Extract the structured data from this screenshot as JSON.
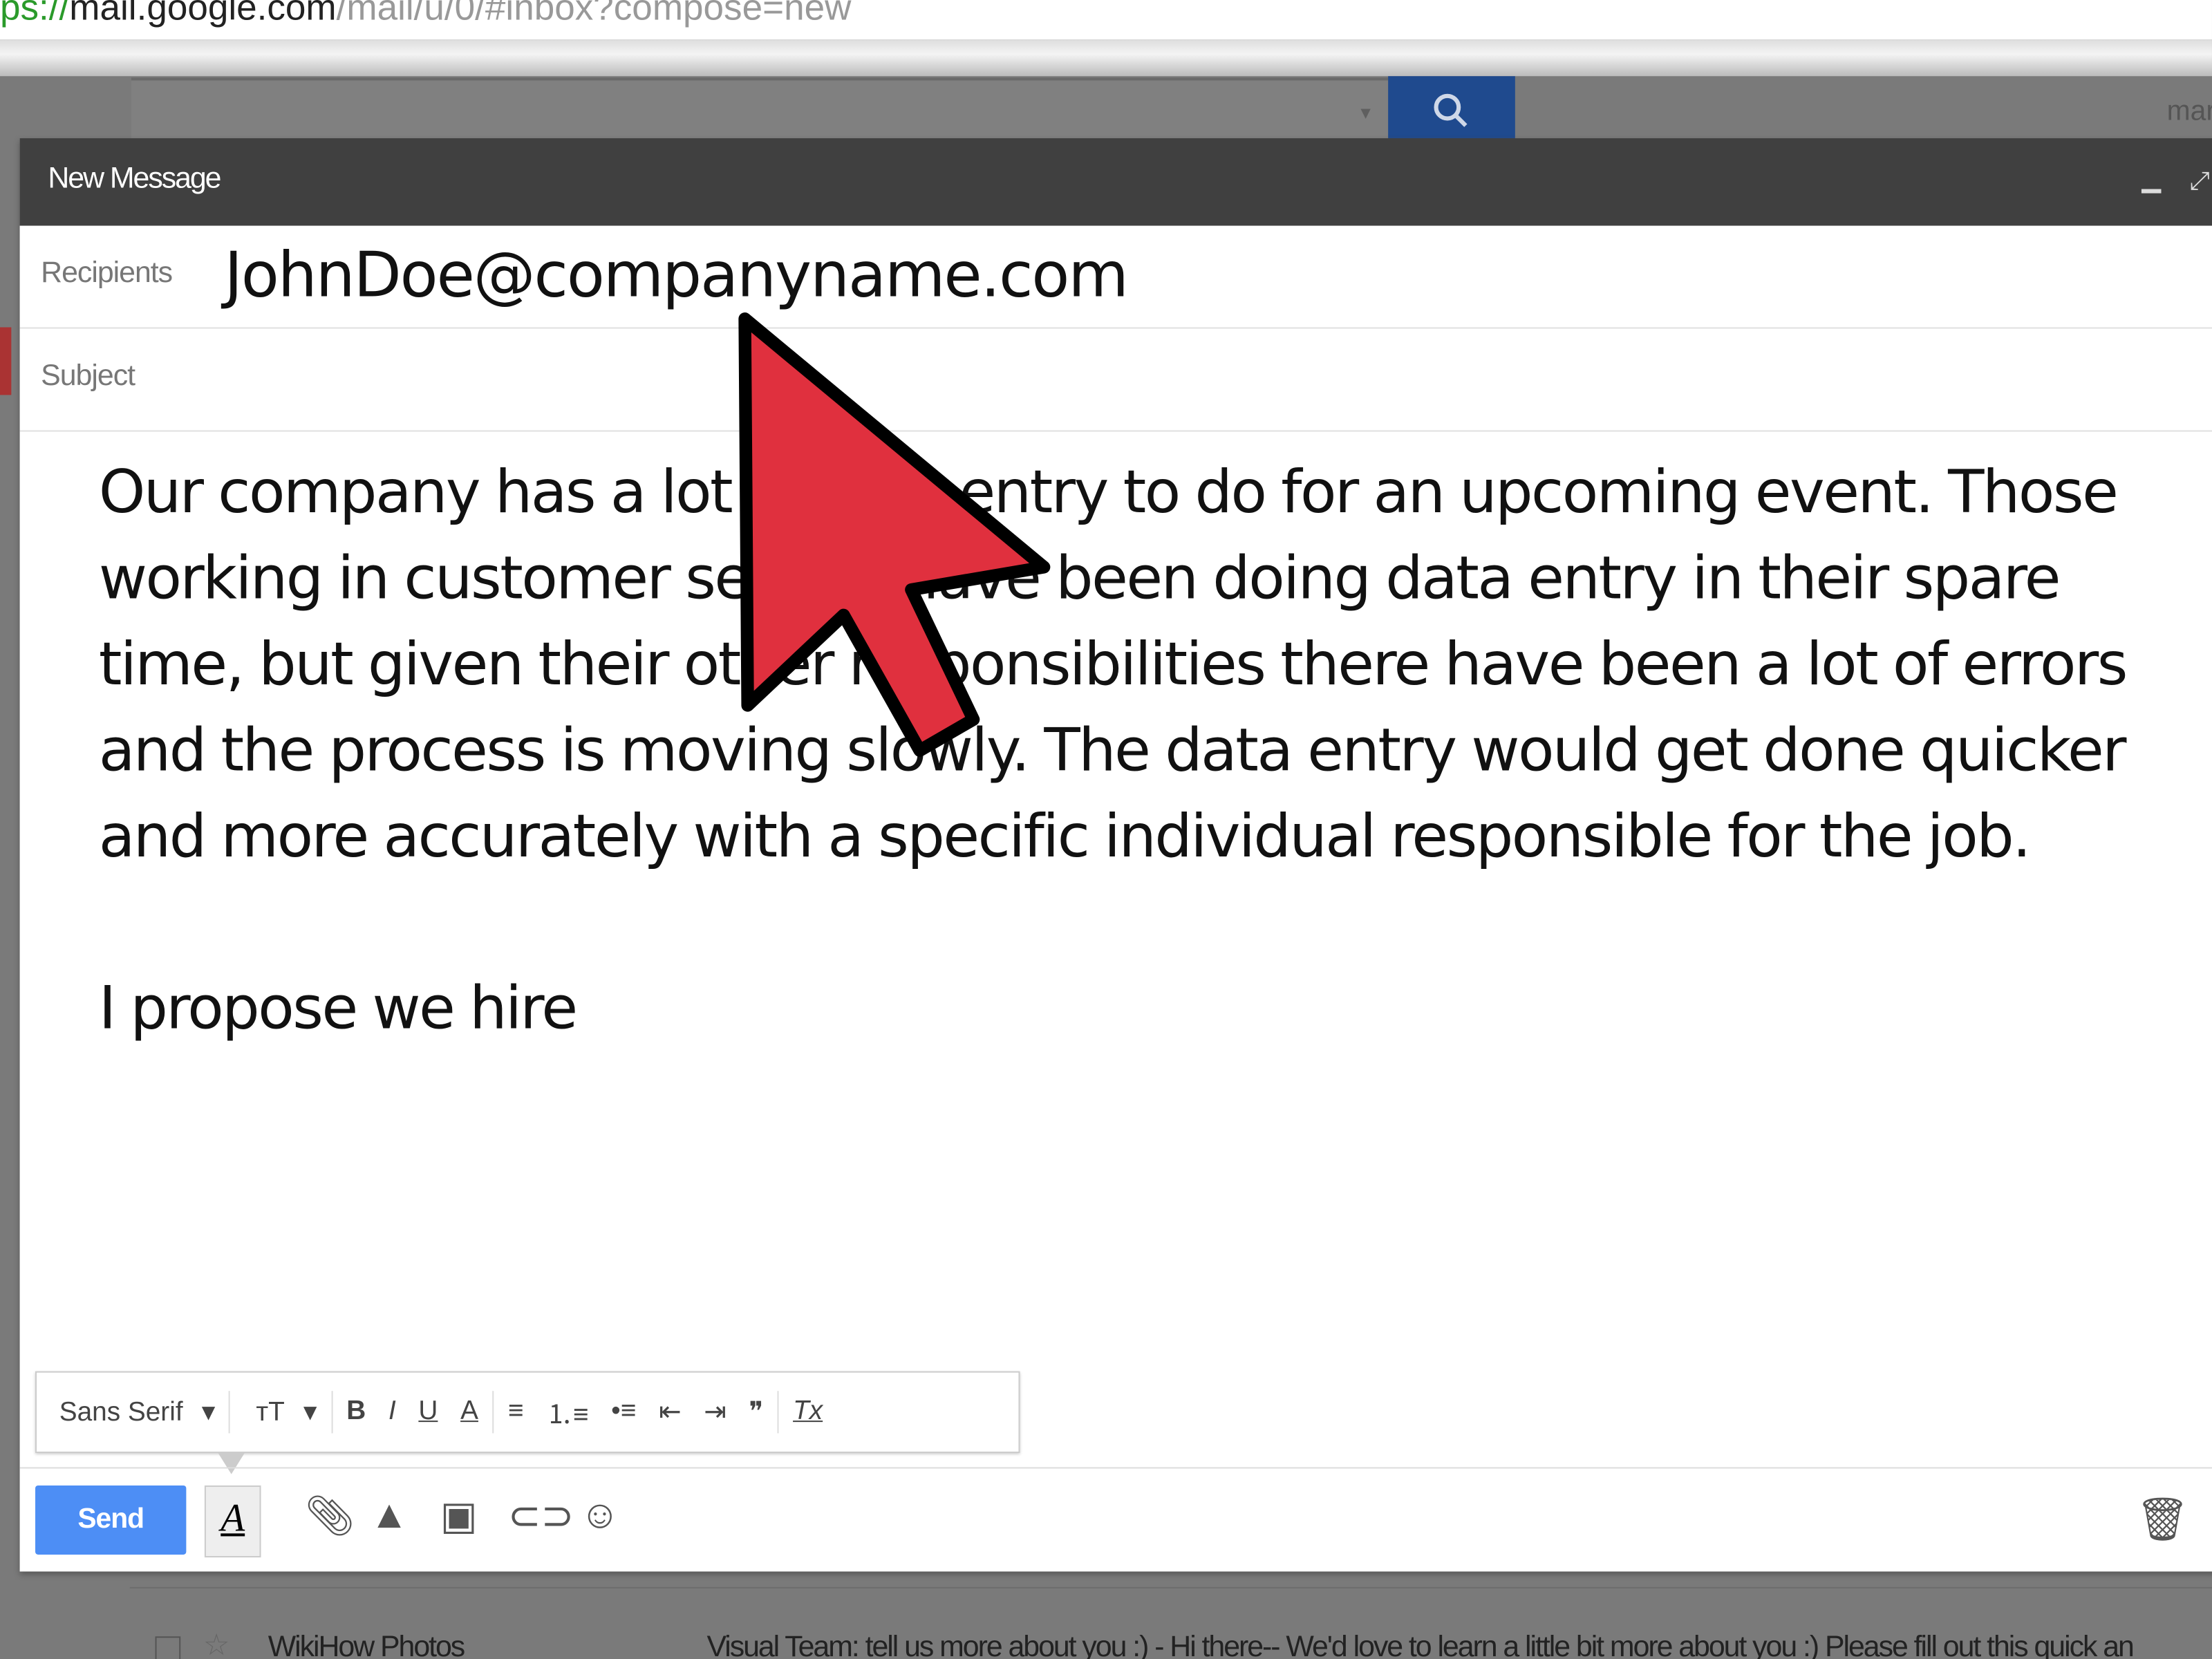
{
  "browser": {
    "url_scheme": "ps://",
    "url_host": "mail.google.com",
    "url_path": "/mail/u/0/#inbox?compose=new"
  },
  "topbar": {
    "search_placeholder": "",
    "search_icon": "search-icon",
    "user_partial": "mar"
  },
  "compose": {
    "title": "New Message",
    "recipients_label": "Recipients",
    "recipients_value": "JohnDoe@companyname.com",
    "subject_label": "Subject",
    "subject_value": "",
    "body_paragraph_1": "Our company has a lot of data entry to do for an upcoming event. Those working in customer service have been doing data entry in their spare time, but given their other responsibilities there have been a lot of errors and the process is moving slowly. The data entry would get done quicker and more accurately with a specific individual responsible for the job.",
    "body_paragraph_2": "I propose we hire",
    "toolbar": {
      "font": "Sans Serif",
      "size": "тT",
      "bold": "B",
      "italic": "I",
      "underline": "U",
      "text_color": "A",
      "align": "≡",
      "numbered": "⒈≡",
      "bulleted": "•≡",
      "outdent": "⇤",
      "indent": "⇥",
      "quote": "❞",
      "clear": "Tx"
    },
    "send_label": "Send",
    "format_label": "A"
  },
  "inbox_row": {
    "sender": "WikiHow Photos",
    "snippet": "Visual Team: tell us more about you :) - Hi there-- We'd love to learn a little bit more about you :) Please fill out this quick an"
  },
  "colors": {
    "send": "#4d8ef5",
    "header": "#404040",
    "cursor": "#e0303e",
    "search_button": "#1f4a8e"
  }
}
